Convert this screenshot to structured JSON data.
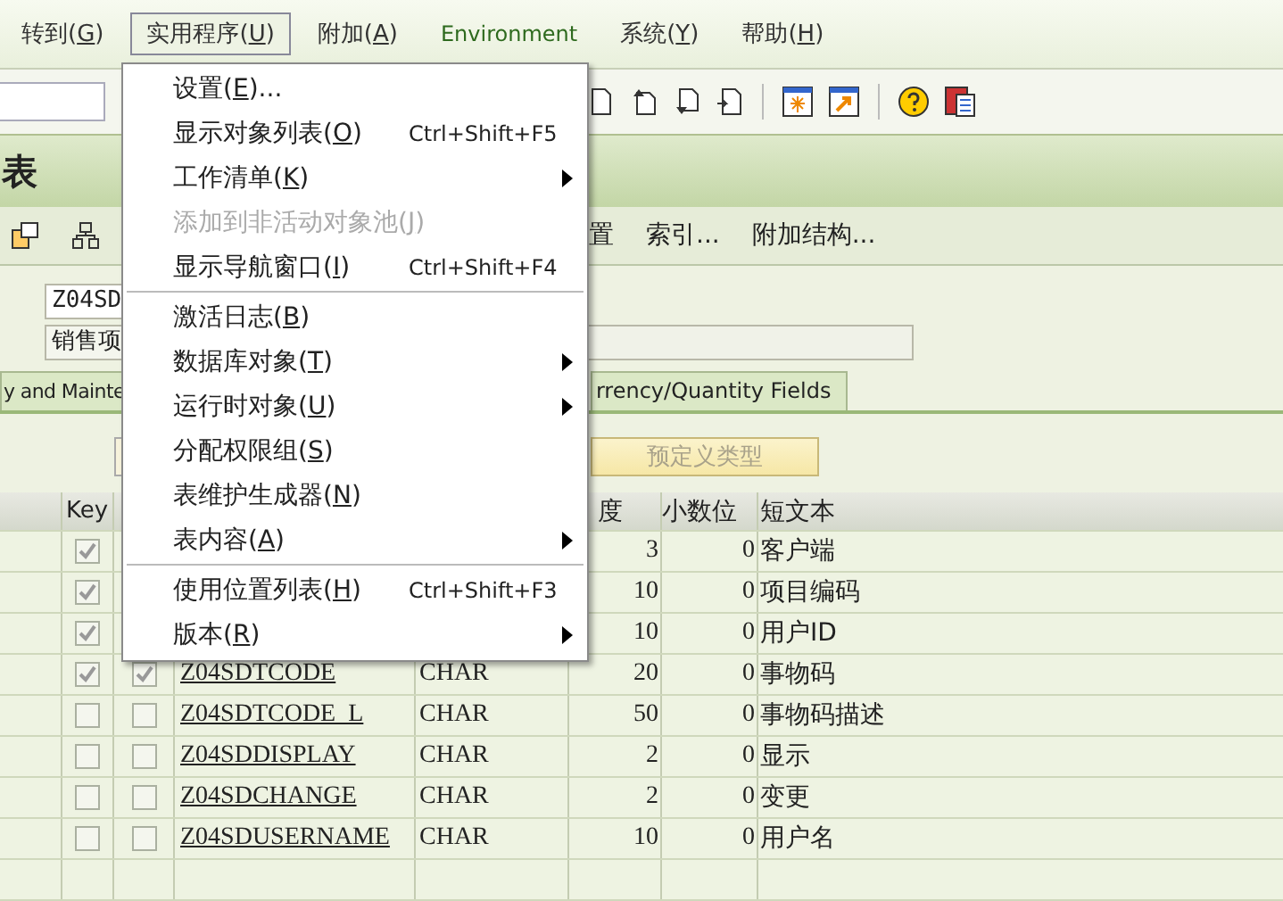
{
  "menubar": [
    {
      "before": "转到(",
      "key": "G",
      "after": ")",
      "selected": false
    },
    {
      "before": "实用程序(",
      "key": "U",
      "after": ")",
      "selected": true
    },
    {
      "before": "附加(",
      "key": "A",
      "after": ")",
      "selected": false
    },
    {
      "before": "Environment",
      "selected": false
    },
    {
      "before": "系统(",
      "key": "Y",
      "after": ")",
      "selected": false
    },
    {
      "before": "帮助(",
      "key": "H",
      "after": ")",
      "selected": false
    }
  ],
  "title": "表",
  "app_toolbar": [
    "置",
    "索引...",
    "附加结构..."
  ],
  "fields": [
    {
      "value": "Z04SD"
    },
    {
      "value": "销售项"
    }
  ],
  "tabs": [
    {
      "label": "y and Mainte",
      "selected": false
    },
    {
      "label": "rrency/Quantity Fields",
      "selected": false
    }
  ],
  "predefined_type_button": {
    "label": "预定义类型",
    "disabled": true
  },
  "table": {
    "header": {
      "key": "Key",
      "length": "度",
      "decimals": "小数位",
      "text": "短文本"
    },
    "rows": [
      {
        "key": true,
        "length": "3",
        "decimals": "0",
        "text": "客户端"
      },
      {
        "key": true,
        "length": "10",
        "decimals": "0",
        "text": "项目编码"
      },
      {
        "key": true,
        "length": "10",
        "decimals": "0",
        "text": "用户ID"
      },
      {
        "key": true,
        "initial": true,
        "name": "Z04SDTCODE",
        "type": "CHAR",
        "length": "20",
        "decimals": "0",
        "text": "事物码"
      },
      {
        "key": false,
        "initial": false,
        "name": "Z04SDTCODE_L",
        "type": "CHAR",
        "length": "50",
        "decimals": "0",
        "text": "事物码描述"
      },
      {
        "key": false,
        "initial": false,
        "name": "Z04SDDISPLAY",
        "type": "CHAR",
        "length": "2",
        "decimals": "0",
        "text": "显示"
      },
      {
        "key": false,
        "initial": false,
        "name": "Z04SDCHANGE",
        "type": "CHAR",
        "length": "2",
        "decimals": "0",
        "text": "变更"
      },
      {
        "key": false,
        "initial": false,
        "name": "Z04SDUSERNAME",
        "type": "CHAR",
        "length": "10",
        "decimals": "0",
        "text": "用户名"
      }
    ]
  },
  "menu": {
    "items": [
      {
        "kind": "item",
        "before": "设置(",
        "key": "E",
        "after": ")...",
        "submenu": false,
        "disabled": false
      },
      {
        "kind": "item",
        "before": "显示对象列表(",
        "key": "O",
        "after": ")",
        "shortcut": "Ctrl+Shift+F5",
        "submenu": false,
        "disabled": false
      },
      {
        "kind": "item",
        "before": "工作清单(",
        "key": "K",
        "after": ")",
        "submenu": true,
        "disabled": false
      },
      {
        "kind": "item",
        "before": "添加到非活动对象池(",
        "key": "J",
        "after": ")",
        "submenu": false,
        "disabled": true
      },
      {
        "kind": "item",
        "before": "显示导航窗口(",
        "key": "I",
        "after": ")",
        "shortcut": "Ctrl+Shift+F4",
        "submenu": false,
        "disabled": false
      },
      {
        "kind": "separator"
      },
      {
        "kind": "item",
        "before": "激活日志(",
        "key": "B",
        "after": ")",
        "submenu": false,
        "disabled": false
      },
      {
        "kind": "item",
        "before": "数据库对象(",
        "key": "T",
        "after": ")",
        "submenu": true,
        "disabled": false
      },
      {
        "kind": "item",
        "before": "运行时对象(",
        "key": "U",
        "after": ")",
        "submenu": true,
        "disabled": false
      },
      {
        "kind": "item",
        "before": "分配权限组(",
        "key": "S",
        "after": ")",
        "submenu": false,
        "disabled": false
      },
      {
        "kind": "item",
        "before": "表维护生成器(",
        "key": "N",
        "after": ")",
        "submenu": false,
        "disabled": false
      },
      {
        "kind": "item",
        "before": "表内容(",
        "key": "A",
        "after": ")",
        "submenu": true,
        "disabled": false
      },
      {
        "kind": "separator"
      },
      {
        "kind": "item",
        "before": "使用位置列表(",
        "key": "H",
        "after": ")",
        "shortcut": "Ctrl+Shift+F3",
        "submenu": false,
        "disabled": false
      },
      {
        "kind": "item",
        "before": "版本(",
        "key": "R",
        "after": ")",
        "submenu": true,
        "disabled": false
      }
    ]
  }
}
